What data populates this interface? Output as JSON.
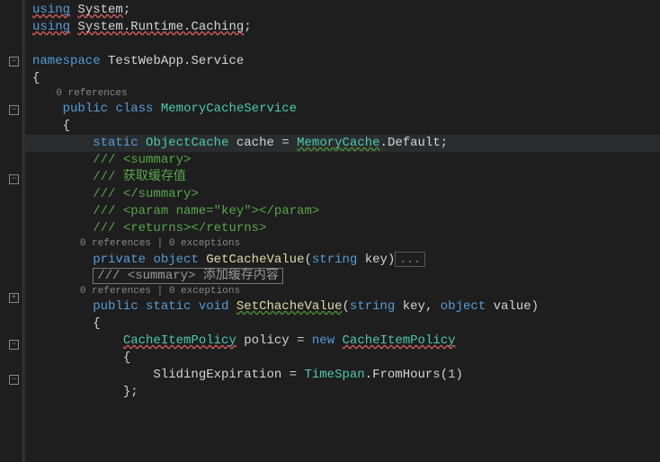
{
  "code": {
    "l1_using": "using",
    "l1_ns": "System",
    "l2_using": "using",
    "l2_ns": "System.Runtime.Caching",
    "ns_kw": "namespace",
    "ns_name": "TestWebApp.Service",
    "codelens1": "0 references",
    "class_public": "public",
    "class_kw": "class",
    "class_name": "MemoryCacheService",
    "static_kw": "static",
    "objcache": "ObjectCache",
    "cache_var": "cache",
    "eq": "=",
    "memcache": "MemoryCache",
    "default": "Default",
    "summary_open": "/// <summary>",
    "summary_body": "/// 获取缓存值",
    "summary_close": "/// </summary>",
    "param_line": "/// <param name=\"key\"></param>",
    "returns_line": "/// <returns></returns>",
    "codelens2": "0 references | 0 exceptions",
    "private_kw": "private",
    "object_kw": "object",
    "getmethod": "GetCacheValue",
    "string_kw": "string",
    "key_param": "key",
    "collapsed": "...",
    "collapsed_summary": "/// <summary> 添加缓存内容",
    "codelens3": "0 references | 0 exceptions",
    "public_kw": "public",
    "void_kw": "void",
    "setmethod": "SetChacheValue",
    "value_param": "value",
    "cacheitempolicy": "CacheItemPolicy",
    "policy_var": "policy",
    "new_kw": "new",
    "sliding": "SlidingExpiration",
    "timespan": "TimeSpan",
    "fromhours": "FromHours",
    "hours_val": "1"
  }
}
